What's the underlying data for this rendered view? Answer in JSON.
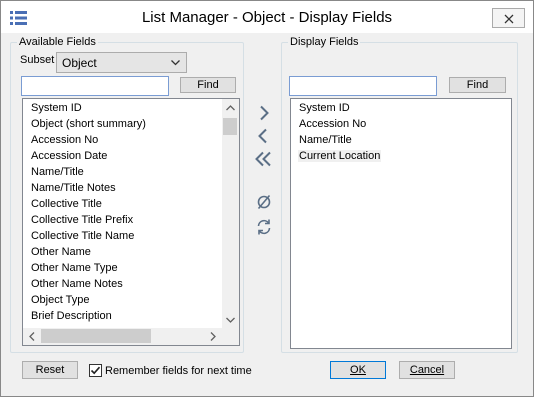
{
  "window": {
    "title": "List Manager - Object - Display Fields"
  },
  "available": {
    "legend": "Available Fields",
    "subset_label": "Subset",
    "subset_value": "Object",
    "find_label": "Find",
    "items": [
      "System ID",
      "Object  (short  summary)",
      "Accession No",
      "Accession Date",
      "Name/Title",
      "Name/Title Notes",
      "Collective Title",
      "Collective Title Prefix",
      "Collective Title Name",
      "Other Name",
      "Other Name Type",
      "Other Name Notes",
      "Object Type",
      "Brief Description"
    ]
  },
  "display": {
    "legend": "Display Fields",
    "find_label": "Find",
    "items": [
      "System ID",
      "Accession No",
      "Name/Title",
      "Current Location"
    ],
    "selected_index": 3
  },
  "footer": {
    "reset_label": "Reset",
    "remember_label": "Remember fields for next time",
    "remember_checked": true,
    "ok_label": "OK",
    "cancel_label": "Cancel"
  },
  "icons": {
    "menu": "hamburger-menu-icon",
    "add": "chevron-right-icon",
    "remove": "chevron-left-icon",
    "remove_all": "double-chevron-left-icon",
    "clear": "empty-set-icon",
    "reset": "refresh-icon"
  },
  "colors": {
    "accent": "#4a6fb5",
    "icon": "#5b6f86"
  }
}
